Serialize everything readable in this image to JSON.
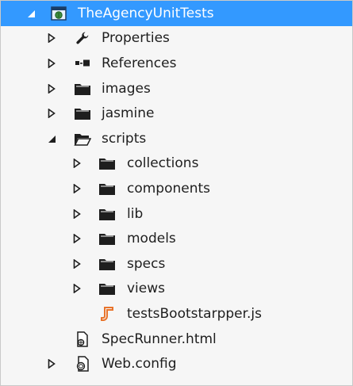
{
  "tree": {
    "project": {
      "label": "TheAgencyUnitTests",
      "expanded": true,
      "selected": true
    },
    "items": [
      {
        "label": "Properties",
        "icon": "wrench-icon",
        "expandable": true,
        "expanded": false
      },
      {
        "label": "References",
        "icon": "references-icon",
        "expandable": true,
        "expanded": false
      },
      {
        "label": "images",
        "icon": "folder-icon",
        "expandable": true,
        "expanded": false
      },
      {
        "label": "jasmine",
        "icon": "folder-icon",
        "expandable": true,
        "expanded": false
      },
      {
        "label": "scripts",
        "icon": "folder-open-icon",
        "expandable": true,
        "expanded": true,
        "children": [
          {
            "label": "collections",
            "icon": "folder-icon",
            "expandable": true,
            "expanded": false
          },
          {
            "label": "components",
            "icon": "folder-icon",
            "expandable": true,
            "expanded": false
          },
          {
            "label": "lib",
            "icon": "folder-icon",
            "expandable": true,
            "expanded": false
          },
          {
            "label": "models",
            "icon": "folder-icon",
            "expandable": true,
            "expanded": false
          },
          {
            "label": "specs",
            "icon": "folder-icon",
            "expandable": true,
            "expanded": false
          },
          {
            "label": "views",
            "icon": "folder-icon",
            "expandable": true,
            "expanded": false
          },
          {
            "label": "testsBootstarpper.js",
            "icon": "js-file-icon",
            "expandable": false
          }
        ]
      },
      {
        "label": "SpecRunner.html",
        "icon": "html-file-icon",
        "expandable": false
      },
      {
        "label": "Web.config",
        "icon": "config-file-icon",
        "expandable": true,
        "expanded": false
      }
    ]
  },
  "colors": {
    "selection": "#3399ff",
    "selection_text": "#ffffff",
    "panel_background": "#f6f6f6",
    "text": "#1e1e1e",
    "js_icon": "#e8742c"
  }
}
